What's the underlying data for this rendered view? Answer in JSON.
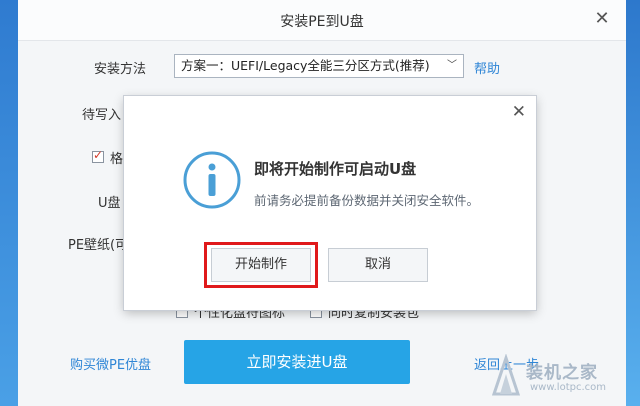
{
  "window": {
    "title": "安装PE到U盘"
  },
  "form": {
    "install_method_label": "安装方法",
    "install_method_value": "方案一：UEFI/Legacy全能三分区方式(推荐)",
    "help_link": "帮助",
    "write_label_partial": "待写入",
    "format_check_label_partial": "格",
    "udisk_label_partial": "U盘",
    "pe_wallpaper_label_partial": "PE壁纸(可",
    "personalize_checkbox": "个性化盘符图标",
    "copy_package_checkbox": "同时复制安装包"
  },
  "footer": {
    "buy_link": "购买微PE优盘",
    "install_button": "立即安装进U盘",
    "back_link": "返回上一步"
  },
  "dialog": {
    "title": "即将开始制作可启动U盘",
    "subtitle": "前请务必提前备份数据并关闭安全软件。",
    "start_button": "开始制作",
    "cancel_button": "取消"
  },
  "watermark": {
    "text": "装机之家",
    "url": "www.lotpc.com"
  },
  "colors": {
    "accent": "#26a4e6",
    "link": "#2f86d6",
    "highlight": "#e0191b"
  }
}
